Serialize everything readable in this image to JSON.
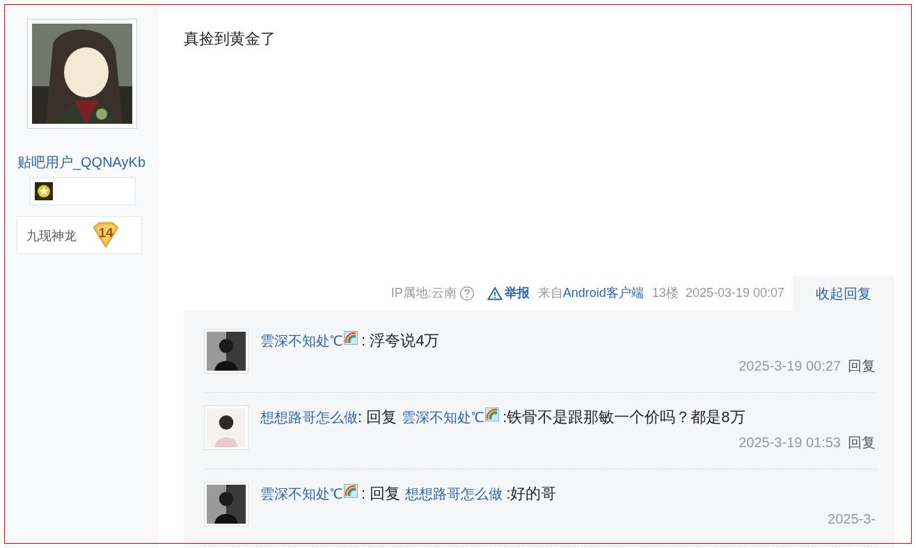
{
  "author": {
    "name": "贴吧用户_QQNAyKb",
    "title": "九现神龙",
    "level": "14"
  },
  "post": {
    "text": "真捡到黄金了",
    "ip_location": "IP属地:云南",
    "report": "举报",
    "source_prefix": "来自",
    "source": "Android客户端",
    "floor": "13楼",
    "time": "2025-03-19 00:07",
    "toggle_replies": "收起回复"
  },
  "replies": [
    {
      "parts": [
        {
          "kind": "user",
          "text": "雲深不知处℃"
        },
        {
          "kind": "emoji"
        },
        {
          "kind": "text",
          "text": ": 浮夸说4万"
        }
      ],
      "time": "2025-3-19 00:27",
      "action": "回复"
    },
    {
      "parts": [
        {
          "kind": "user",
          "text": "想想路哥怎么做"
        },
        {
          "kind": "text",
          "text": ": 回复"
        },
        {
          "kind": "user",
          "text": "雲深不知处℃"
        },
        {
          "kind": "emoji"
        },
        {
          "kind": "text",
          "text": ":铁骨不是跟那敏一个价吗？都是8万"
        }
      ],
      "time": "2025-3-19 01:53",
      "action": "回复"
    },
    {
      "parts": [
        {
          "kind": "user",
          "text": "雲深不知处℃"
        },
        {
          "kind": "emoji"
        },
        {
          "kind": "text",
          "text": ": 回复"
        },
        {
          "kind": "user",
          "text": "想想路哥怎么做"
        },
        {
          "kind": "text",
          "text": ":好的哥"
        }
      ],
      "time": "2025-3-"
    }
  ]
}
